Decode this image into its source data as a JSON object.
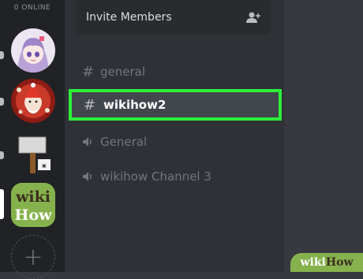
{
  "rail": {
    "online_label": "0 ONLINE",
    "servers": [
      {
        "name": "anime-avatar-server"
      },
      {
        "name": "santa-illustration-server"
      },
      {
        "name": "hammer-server"
      },
      {
        "name": "wikihow-server",
        "logo_text_top": "wiki",
        "logo_text_bottom": "How"
      }
    ],
    "add_server_symbol": "+"
  },
  "sidebar": {
    "invite_label": "Invite Members",
    "channels": [
      {
        "type": "text",
        "glyph": "#",
        "name": "general"
      },
      {
        "type": "text",
        "glyph": "#",
        "name": "wikihow2",
        "selected": true
      },
      {
        "type": "voice",
        "glyph": "speaker-icon",
        "name": "General"
      },
      {
        "type": "voice",
        "glyph": "speaker-icon",
        "name": "wikihow Channel 3"
      }
    ]
  },
  "watermark": {
    "part1": "wiki",
    "part2": "How"
  },
  "colors": {
    "highlight": "#2cf03a",
    "rail": "#202225",
    "sidebar": "#2f3136",
    "main": "#36393f"
  }
}
